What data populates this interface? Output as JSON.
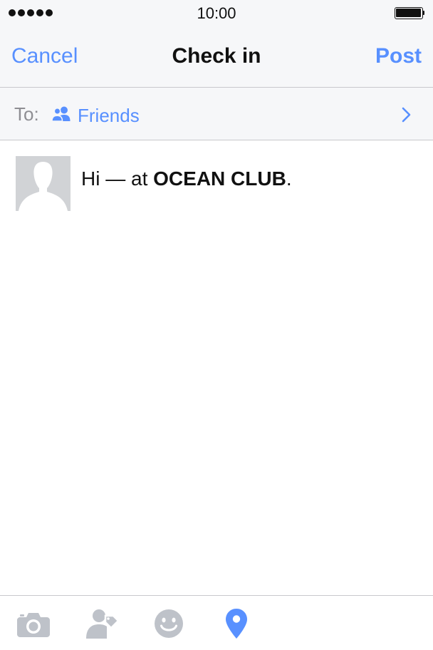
{
  "status_bar": {
    "time": "10:00",
    "signal_dots": 5,
    "battery_level": 1.0
  },
  "nav": {
    "cancel_label": "Cancel",
    "title": "Check in",
    "post_label": "Post"
  },
  "audience": {
    "to_label": "To:",
    "value": "Friends",
    "icon": "friends-icon"
  },
  "composer": {
    "text_before": "Hi — at ",
    "place": "OCEAN CLUB",
    "text_after": "."
  },
  "toolbar": {
    "items": [
      {
        "icon": "camera-icon",
        "active": false
      },
      {
        "icon": "tag-people-icon",
        "active": false
      },
      {
        "icon": "feeling-icon",
        "active": false
      },
      {
        "icon": "location-pin-icon",
        "active": true
      }
    ]
  },
  "colors": {
    "accent": "#5890ff",
    "inactive_icon": "#bec2c9",
    "bar_background": "#f6f7f9",
    "separator": "#c8c8cc"
  }
}
